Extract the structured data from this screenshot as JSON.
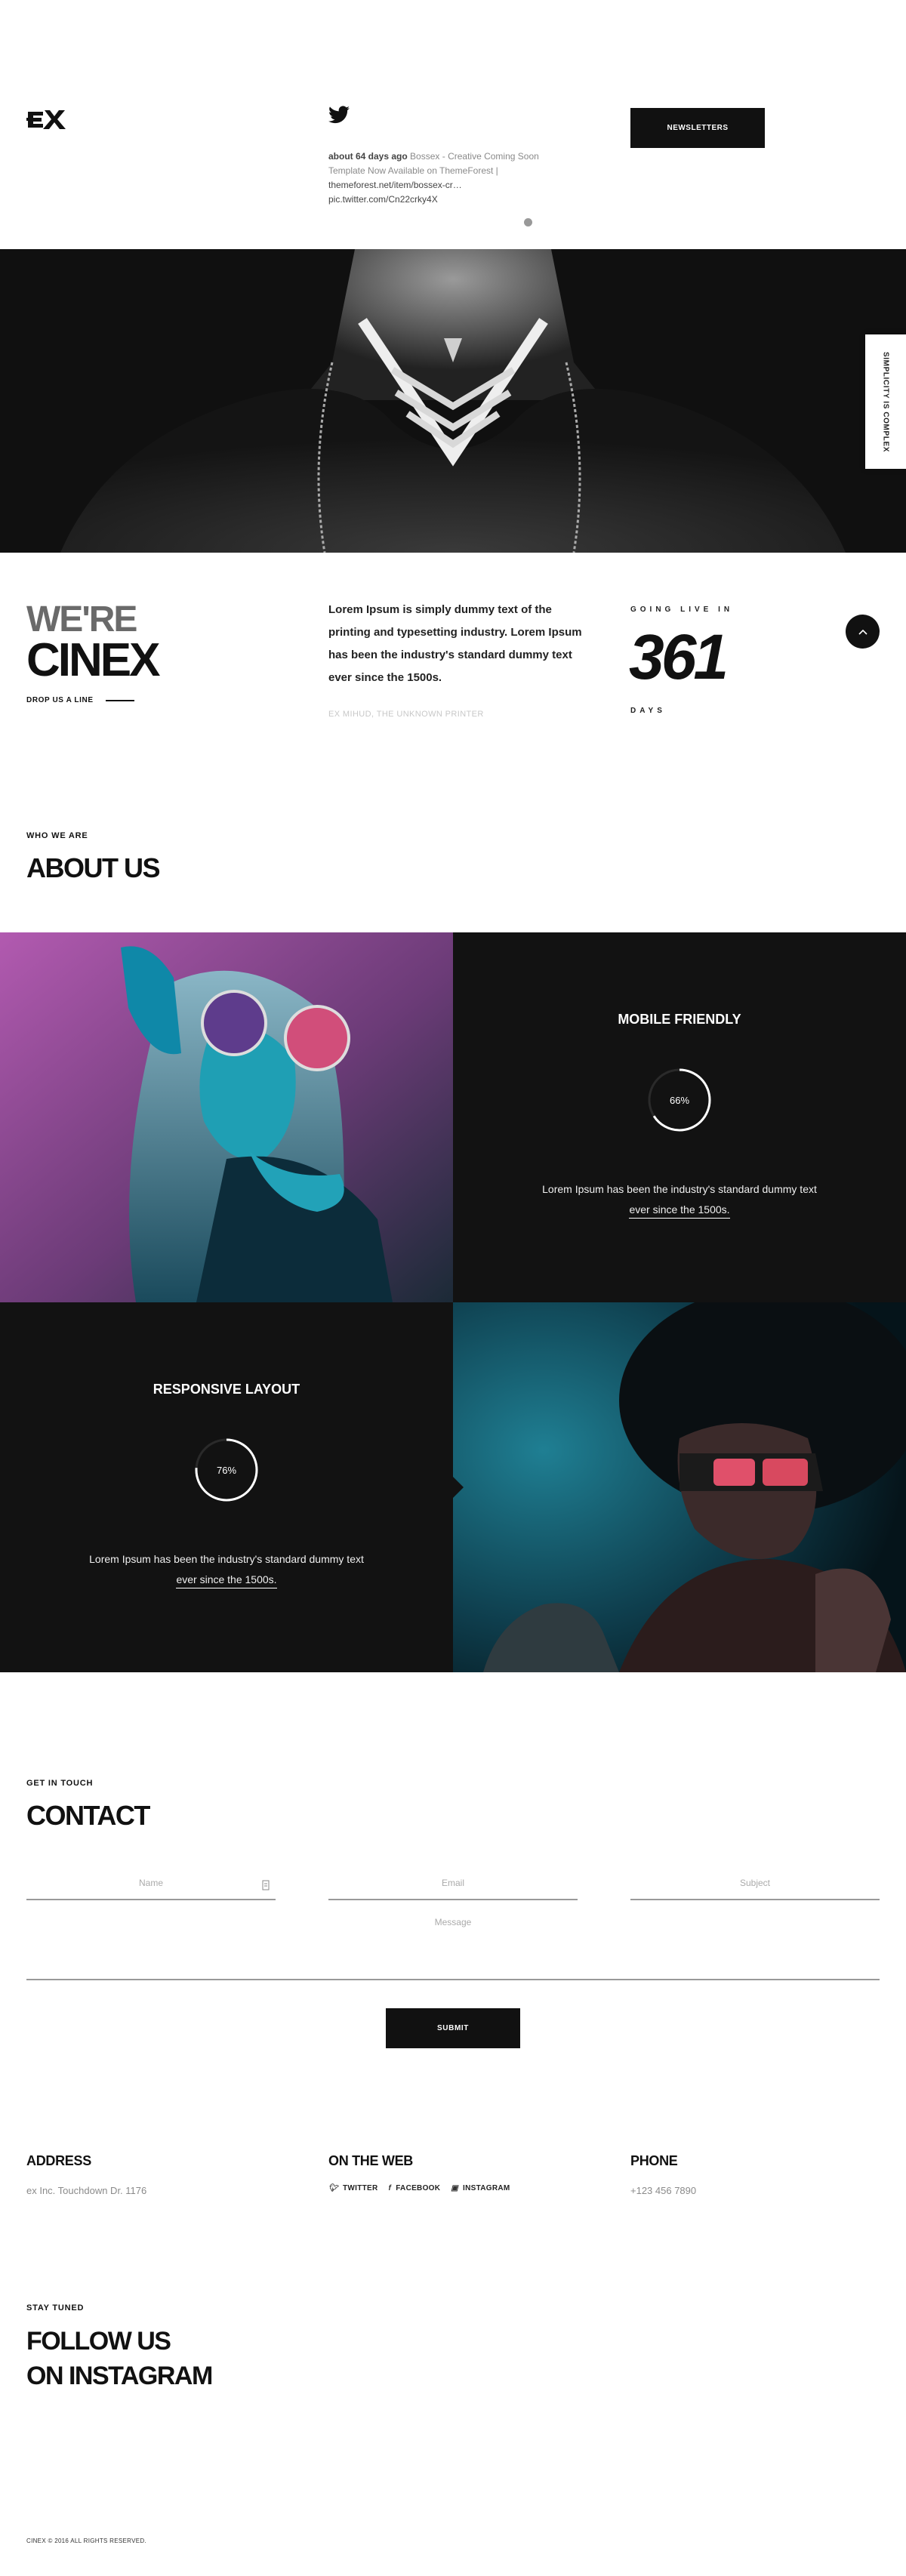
{
  "header": {
    "tweet": {
      "ago": "about 64 days ago",
      "text": "Bossex - Creative Coming Soon Template Now Available on ThemeForest |",
      "link1": "themeforest.net/item/bossex-cr…",
      "link2": "pic.twitter.com/Cn22crky4X"
    },
    "newsletter_label": "NEWSLETTERS"
  },
  "side_tab": "SIMPLICITY IS COMPLEX",
  "intro": {
    "title_line1": "WE'RE",
    "title_line2": "CINEX",
    "drop_label": "DROP US A LINE",
    "text": "Lorem Ipsum is simply dummy text of the printing and typesetting industry. Lorem Ipsum has been the industry's standard dummy text ever since the 1500s.",
    "author": "EX MIHUD, THE UNKNOWN PRINTER",
    "going_live": "GOING LIVE IN",
    "count": "361",
    "days": "DAYS",
    "scroll_up_icon": "chevron-up-icon"
  },
  "about": {
    "eyebrow": "WHO WE ARE",
    "title": "ABOUT US",
    "features": [
      {
        "title": "MOBILE FRIENDLY",
        "percent": "66%",
        "value": 0.66,
        "text_a": "Lorem Ipsum has been the industry's standard dummy text",
        "text_b": "ever since the 1500s."
      },
      {
        "title": "RESPONSIVE LAYOUT",
        "percent": "76%",
        "value": 0.76,
        "text_a": "Lorem Ipsum has been the industry's standard dummy text",
        "text_b": "ever since the 1500s."
      }
    ]
  },
  "contact": {
    "eyebrow": "GET IN TOUCH",
    "title": "CONTACT",
    "name_placeholder": "Name",
    "email_placeholder": "Email",
    "subject_placeholder": "Subject",
    "message_placeholder": "Message",
    "submit_label": "SUBMIT"
  },
  "info": {
    "address_heading": "ADDRESS",
    "address_text": "ex Inc. Touchdown Dr. 1176",
    "web_heading": "ON THE WEB",
    "socials": [
      "TWITTER",
      "FACEBOOK",
      "INSTAGRAM"
    ],
    "phone_heading": "PHONE",
    "phone_text": "+123 456 7890"
  },
  "instagram": {
    "eyebrow": "STAY TUNED",
    "line1": "FOLLOW US",
    "line2": "ON INSTAGRAM"
  },
  "footer": {
    "copyright": "CINEX © 2016 ALL RIGHTS RESERVED."
  },
  "colors": {
    "dark": "#121212",
    "accent_white": "#ffffff"
  }
}
